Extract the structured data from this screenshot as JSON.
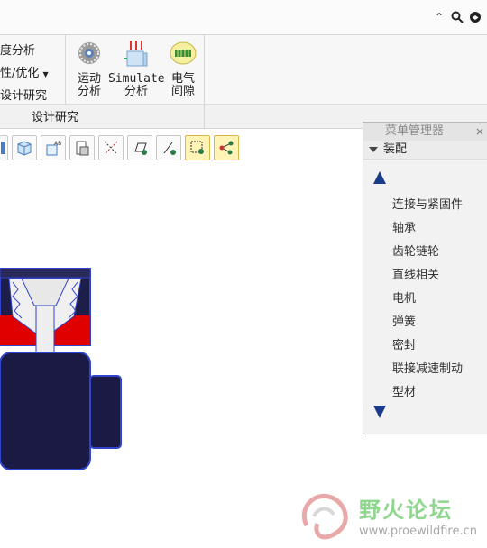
{
  "ribbon": {
    "left_items": [
      "度分析",
      "性/优化",
      "设计研究"
    ],
    "buttons": [
      {
        "line1": "运动",
        "line2": "分析"
      },
      {
        "line1": "Simulate",
        "line2": "分析"
      },
      {
        "line1": "电气",
        "line2": "间隙"
      }
    ],
    "group_label": "设计研究"
  },
  "menu_manager": {
    "title": "菜单管理器",
    "close": "×",
    "header": "装配",
    "items": [
      "连接与紧固件",
      "轴承",
      "齿轮链轮",
      "直线相关",
      "电机",
      "弹簧",
      "密封",
      "联接减速制动",
      "型材"
    ]
  },
  "watermark": {
    "name": "野火论坛",
    "url": "www.proewildfire.cn"
  },
  "colors": {
    "accent_blue": "#1a3a8a",
    "model_red": "#e00000",
    "model_dark": "#1e1e4a"
  }
}
